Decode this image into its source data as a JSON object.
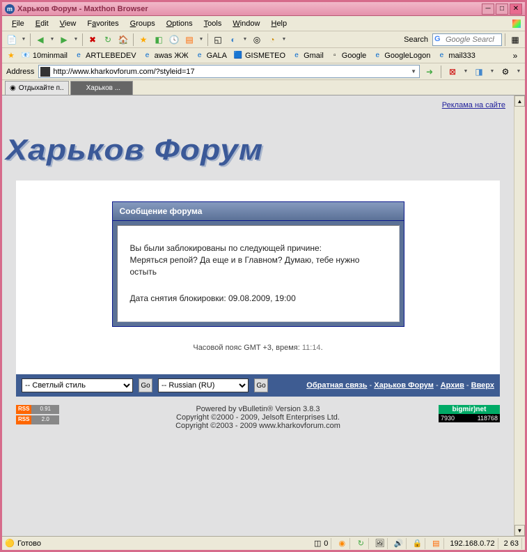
{
  "window": {
    "title": "Харьков Форум - Maxthon Browser"
  },
  "menu": {
    "file": "File",
    "edit": "Edit",
    "view": "View",
    "favorites": "Favorites",
    "groups": "Groups",
    "options": "Options",
    "tools": "Tools",
    "window": "Window",
    "help": "Help"
  },
  "search": {
    "label": "Search",
    "placeholder": "Google Search"
  },
  "bookmarks": {
    "b1": "10minmail",
    "b2": "ARTLEBEDEV",
    "b3": "awas ЖЖ",
    "b4": "GALA",
    "b5": "GISMETEO",
    "b6": "Gmail",
    "b7": "Google",
    "b8": "GoogleLogon",
    "b9": "mail333"
  },
  "address": {
    "label": "Address",
    "url": "http://www.kharkovforum.com/?styleid=17"
  },
  "tabs": {
    "t1": "Отдыхайте п..",
    "t2": "Харьков ..."
  },
  "page": {
    "ad_link": "Реклама на сайте",
    "logo": "Харьков Форум",
    "msg_header": "Сообщение форума",
    "msg_line1": "Вы были заблокированы по следующей причине:",
    "msg_line2": "Меряться репой? Да еще и в Главном? Думаю, тебе нужно остыть",
    "msg_date": "Дата снятия блокировки: 09.08.2009, 19:00",
    "tz_prefix": "Часовой пояс GMT +3, время: ",
    "tz_time": "11:14",
    "style_select": "-- Светлый стиль",
    "lang_select": "-- Russian (RU)",
    "nav_contact": "Обратная связь",
    "nav_forum": "Харьков Форум",
    "nav_archive": "Архив",
    "nav_top": "Вверх",
    "footer1": "Powered by vBulletin® Version 3.8.3",
    "footer2": "Copyright ©2000 - 2009, Jelsoft Enterprises Ltd.",
    "footer3": "Copyright ©2003 - 2009 www.kharkovforum.com",
    "rss1": "0.91",
    "rss2": "2.0",
    "bigmir_name": "bigmir)net",
    "bigmir_n1": "7930",
    "bigmir_n2": "118768"
  },
  "status": {
    "ready": "Готово",
    "zero": "0",
    "ip": "192.168.0.72",
    "pct": "2 63"
  }
}
